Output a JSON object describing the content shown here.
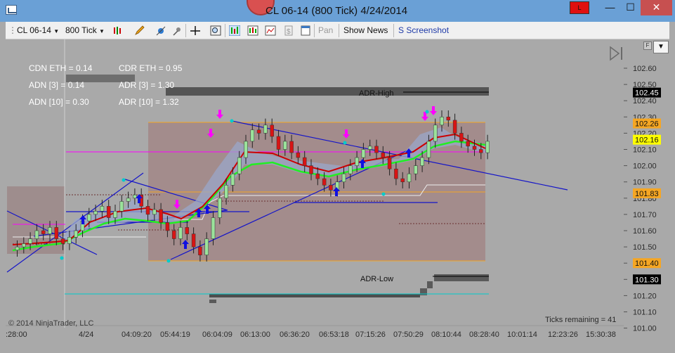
{
  "window": {
    "title": "CL 06-14 (800 Tick)  4/24/2014",
    "instrument_badge": "L",
    "min_label": "—",
    "max_label": "☐",
    "close_label": "✕"
  },
  "toolbar": {
    "instrument": "CL 06-14",
    "period": "800 Tick",
    "pan_label": "Pan",
    "show_news_label": "Show News",
    "screenshot_label": "S Screenshot"
  },
  "overlay": {
    "cdn_eth": "CDN ETH = 0.14",
    "cdr_eth": "CDR ETH = 0.95",
    "adn3": "ADN [3] = 0.14",
    "adr3": "ADR [3] = 1.30",
    "adn10": "ADN [10] = 0.30",
    "adr10": "ADR [10] = 1.32",
    "adr_high": "ADR-High",
    "adr_low": "ADR-Low",
    "copyright": "© 2014 NinjaTrader, LLC",
    "ticks_remaining": "Ticks remaining = 41"
  },
  "price_axis": {
    "ticks": [
      "102.60",
      "102.50",
      "102.40",
      "102.30",
      "102.20",
      "102.10",
      "102.00",
      "101.90",
      "101.80",
      "101.70",
      "101.60",
      "101.50",
      "101.40",
      "101.30",
      "101.20",
      "101.10",
      "101.00"
    ],
    "markers": [
      {
        "label": "102.45",
        "bg": "#000000",
        "fg": "#ffffff"
      },
      {
        "label": "102.26",
        "bg": "#f5a623",
        "fg": "#111111"
      },
      {
        "label": "102.16",
        "bg": "#ffff00",
        "fg": "#111111"
      },
      {
        "label": "101.83",
        "bg": "#f5a623",
        "fg": "#111111"
      },
      {
        "label": "101.40",
        "bg": "#f5a623",
        "fg": "#111111"
      },
      {
        "label": "101.30",
        "bg": "#000000",
        "fg": "#ffffff"
      }
    ]
  },
  "time_axis": {
    "labels": [
      ":28:00",
      "4/24",
      "04:09:20",
      "05:44:19",
      "06:04:09",
      "06:13:00",
      "06:36:20",
      "06:53:18",
      "07:15:26",
      "07:50:29",
      "08:10:44",
      "08:28:40",
      "10:01:14",
      "12:23:26",
      "15:30:38"
    ]
  },
  "colors": {
    "window_bg": "#a9a9a9",
    "range_box": "#a08b8b",
    "channel": "#1515c8",
    "ema_fast": "#22ee22",
    "ema_slow": "#cc0000",
    "up_bar": "#9be39b",
    "down_bar": "#d81414",
    "magenta": "#ff00ff",
    "cyan": "#00cccc",
    "orange": "#f5a623"
  }
}
